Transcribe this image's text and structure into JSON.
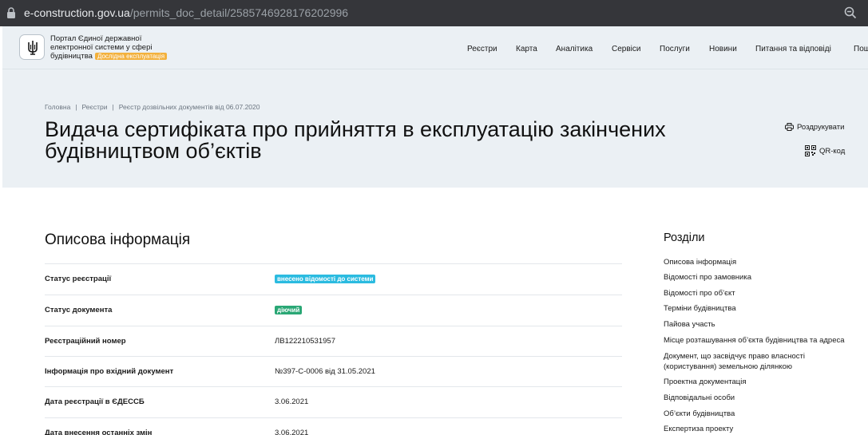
{
  "browser": {
    "url_host": "e-construction.gov.ua",
    "url_path": "/permits_doc_detail/2585746928176202996",
    "bar_color": "#35363a"
  },
  "header": {
    "portal_title": "Портал Єдиної державної електронної системи у сфері будівництва",
    "beta_badge": "Дослідна експлуатація",
    "beta_color": "#f3b13d",
    "nav": [
      "Реєстри",
      "Карта",
      "Аналітика",
      "Сервіси",
      "Послуги",
      "Новини",
      "Питання та відповіді",
      "Пош"
    ]
  },
  "breadcrumb": [
    "Головна",
    "Реєстри",
    "Реєстр дозвільних документів від 06.07.2020"
  ],
  "page": {
    "title": "Видача сертифіката про прийняття в експлуатацію закінчених будівництвом об’єктів",
    "print_label": "Роздрукувати",
    "qr_label": "QR-код"
  },
  "description": {
    "title": "Описова інформація",
    "rows": [
      {
        "label": "Статус реєстрації",
        "value": "внесено відомості до системи",
        "badge_color": "#2bbbe0"
      },
      {
        "label": "Статус документа",
        "value": "діючий",
        "badge_color": "#2aa775"
      },
      {
        "label": "Реєстраційний номер",
        "value": "ЛВ122210531957"
      },
      {
        "label": "Інформація про вхідний документ",
        "value": "№397-С-0006 від 31.05.2021"
      },
      {
        "label": "Дата реєстрації в ЄДЕССБ",
        "value": "3.06.2021"
      },
      {
        "label": "Дата внесення останніх змін",
        "value": "3.06.2021"
      }
    ]
  },
  "sections": {
    "title": "Розділи",
    "items": [
      "Описова інформація",
      "Відомості про замовника",
      "Відомості про об’єкт",
      "Терміни будівництва",
      "Пайова участь",
      "Місце розташування об’єкта будівництва та адреса",
      "Документ, що засвідчує право власності (користування) земельною ділянкою",
      "Проектна документація",
      "Відповідальні особи",
      "Об’єкти будівництва",
      "Експертиза проекту"
    ]
  },
  "colors": {
    "header_bg": "#ebf0f4",
    "divider": "#e3e7eb"
  }
}
